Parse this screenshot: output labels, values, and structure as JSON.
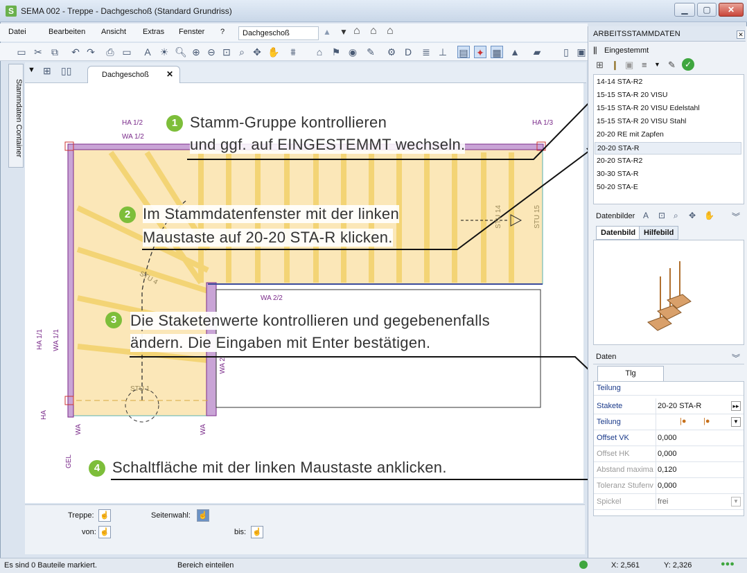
{
  "window": {
    "title": "SEMA  002 - Treppe  - Dachgeschoß (Standard Grundriss)",
    "logo_letter": "S"
  },
  "menu": {
    "items": [
      "Datei",
      "Bearbeiten",
      "Ansicht",
      "Extras",
      "Fenster",
      "?"
    ],
    "level_select": "Dachgeschoß"
  },
  "tabs": {
    "doc_tab": "Dachgeschoß",
    "side_tab": "Stammdaten Container"
  },
  "canvas": {
    "labels": {
      "ha12": "HA 1/2",
      "wa12": "WA 1/2",
      "ha13": "HA 1/3",
      "ha11": "HA 1/1",
      "wa11": "WA 1/1",
      "wa22": "WA 2/2",
      "ha": "HA",
      "wa_a": "WA",
      "wa_b": "WA",
      "gel": "GEL",
      "stu1": "STU 1",
      "stu4": "STU 4",
      "stu14": "STU 14",
      "stu15": "STU 15",
      "wa_v": "WA 2"
    },
    "callouts": [
      {
        "num": "1",
        "line1": "Stamm-Gruppe kontrollieren",
        "line2": "und ggf. auf  EINGESTEMMT  wechseln."
      },
      {
        "num": "2",
        "line1": "Im Stammdatenfenster mit der linken",
        "line2": "Maustaste auf  20-20 STA-R  klicken."
      },
      {
        "num": "3",
        "line1": "Die Staketenwerte kontrollieren und gegebenenfalls",
        "line2": "ändern. Die Eingaben mit Enter bestätigen."
      },
      {
        "num": "4",
        "line1": "Schaltfläche mit der linken Maustaste anklicken."
      }
    ]
  },
  "panel": {
    "title": "ARBEITSSTAMMDATEN",
    "group": "Eingestemmt",
    "list": [
      "14-14 STA-R2",
      "15-15 STA-R 20 VISU",
      "15-15 STA-R 20 VISU Edelstahl",
      "15-15 STA-R 20 VISU Stahl",
      "20-20 RE mit Zapfen",
      "20-20 STA-R",
      "20-20 STA-R2",
      "30-30 STA-R",
      "50-20 STA-E"
    ],
    "selected_index": 5,
    "bilder_header": "Datenbilder",
    "bild_tabs": [
      "Datenbild",
      "Hilfebild"
    ],
    "daten_header": "Daten",
    "daten_tab": "Tlg",
    "section": "Teilung",
    "rows": [
      {
        "label": "Stakete",
        "value": "20-20 STA-R"
      },
      {
        "label": "Teilung",
        "value": ""
      },
      {
        "label": "Offset VK",
        "value": "0,000"
      },
      {
        "label": "Offset HK",
        "value": "0,000"
      },
      {
        "label": "Abstand maxima",
        "value": "0,120"
      },
      {
        "label": "Toleranz Stufenv",
        "value": "0,000"
      },
      {
        "label": "Spickel",
        "value": "frei"
      }
    ]
  },
  "bottom": {
    "treppe": "Treppe:",
    "seitenwahl": "Seitenwahl:",
    "von": "von:",
    "bis": "bis:"
  },
  "status": {
    "left": "Es sind 0 Bauteile markiert.",
    "middle": "Bereich einteilen",
    "x": "X:  2,561",
    "y": "Y:  2,326"
  },
  "colors": {
    "accent_green": "#7dbe3a",
    "floor": "#fbe7b8",
    "wall_purple": "#7a2a8a"
  }
}
